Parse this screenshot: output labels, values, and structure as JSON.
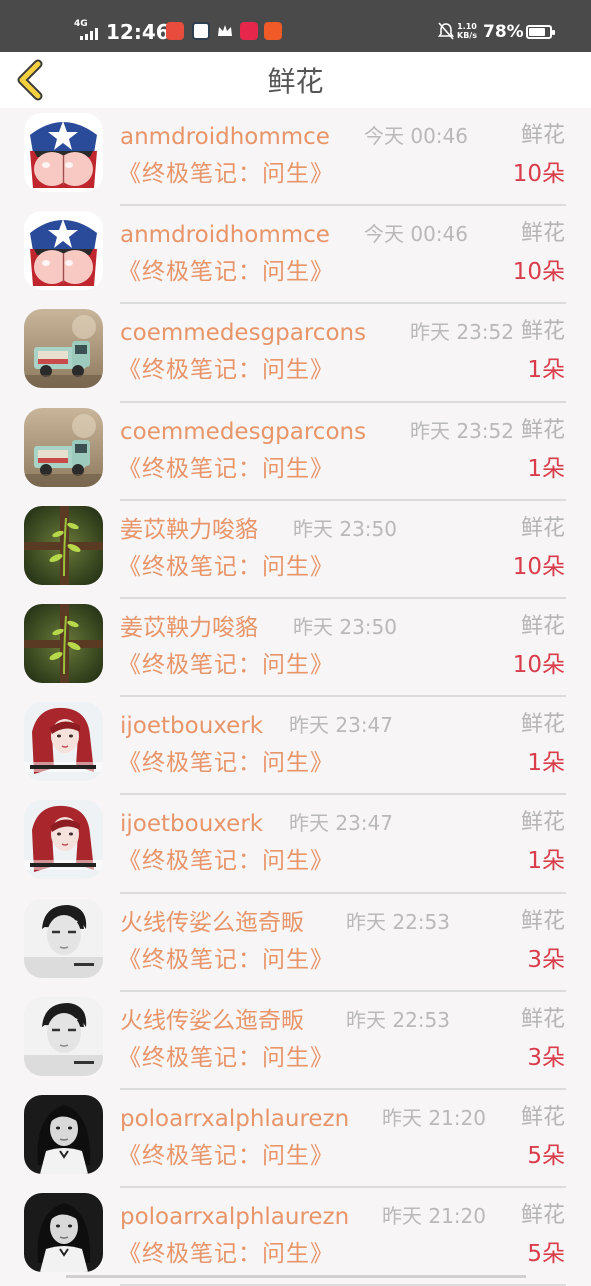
{
  "status_bar": {
    "network": "4G",
    "time": "12:46",
    "speed_value": "1.10",
    "speed_unit": "KB/s",
    "battery_text": "78%",
    "battery_level": 0.78
  },
  "header": {
    "title": "鲜花"
  },
  "colors": {
    "name": "#e8956a",
    "count": "#d93c4a",
    "label": "#b5b5b5",
    "back_icon": "#f4d03f"
  },
  "list": {
    "items": [
      {
        "name": "anmdroidhommce",
        "time": "今天 00:46",
        "label": "鲜花",
        "book": "《终极笔记：问生》",
        "count": "10朵",
        "avatar": "captain-america-avatar"
      },
      {
        "name": "anmdroidhommce",
        "time": "今天 00:46",
        "label": "鲜花",
        "book": "《终极笔记：问生》",
        "count": "10朵",
        "avatar": "captain-america-avatar"
      },
      {
        "name": "coemmedesgparcons",
        "time": "昨天 23:52",
        "label": "鲜花",
        "book": "《终极笔记：问生》",
        "count": "1朵",
        "avatar": "toy-truck-avatar"
      },
      {
        "name": "coemmedesgparcons",
        "time": "昨天 23:52",
        "label": "鲜花",
        "book": "《终极笔记：问生》",
        "count": "1朵",
        "avatar": "toy-truck-avatar"
      },
      {
        "name": "姜苡鞅力唆貉",
        "time": "昨天 23:50",
        "label": "鲜花",
        "book": "《终极笔记：问生》",
        "count": "10朵",
        "avatar": "plant-fence-avatar"
      },
      {
        "name": "姜苡鞅力唆貉",
        "time": "昨天 23:50",
        "label": "鲜花",
        "book": "《终极笔记：问生》",
        "count": "10朵",
        "avatar": "plant-fence-avatar"
      },
      {
        "name": "ijoetbouxerk",
        "time": "昨天 23:47",
        "label": "鲜花",
        "book": "《终极笔记：问生》",
        "count": "1朵",
        "avatar": "red-hair-girl-avatar"
      },
      {
        "name": "ijoetbouxerk",
        "time": "昨天 23:47",
        "label": "鲜花",
        "book": "《终极笔记：问生》",
        "count": "1朵",
        "avatar": "red-hair-girl-avatar"
      },
      {
        "name": "火线传娑么迤奇畈",
        "time": "昨天 22:53",
        "label": "鲜花",
        "book": "《终极笔记：问生》",
        "count": "3朵",
        "avatar": "bw-boy-avatar"
      },
      {
        "name": "火线传娑么迤奇畈",
        "time": "昨天 22:53",
        "label": "鲜花",
        "book": "《终极笔记：问生》",
        "count": "3朵",
        "avatar": "bw-boy-avatar"
      },
      {
        "name": "poloarrxalphlaurezn",
        "time": "昨天 21:20",
        "label": "鲜花",
        "book": "《终极笔记：问生》",
        "count": "5朵",
        "avatar": "bw-girl-avatar"
      },
      {
        "name": "poloarrxalphlaurezn",
        "time": "昨天 21:20",
        "label": "鲜花",
        "book": "《终极笔记：问生》",
        "count": "5朵",
        "avatar": "bw-girl-avatar"
      }
    ]
  }
}
